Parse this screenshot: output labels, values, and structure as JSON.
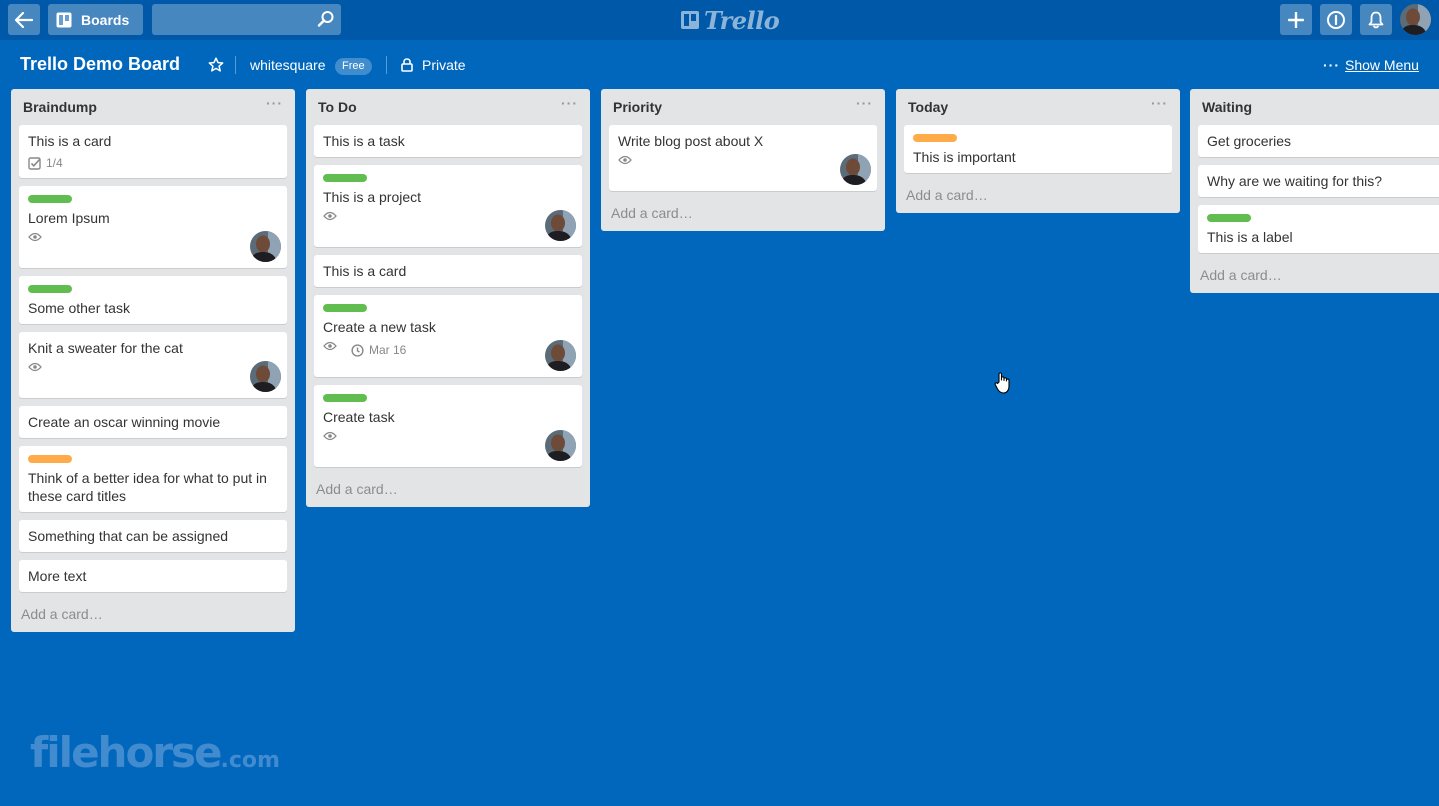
{
  "header": {
    "boards_label": "Boards",
    "search_value": "",
    "logo_text": "Trello",
    "icons": [
      "back-arrow-icon",
      "boards-icon",
      "search-icon",
      "trello-logo-icon",
      "plus-icon",
      "info-icon",
      "bell-icon",
      "user-avatar"
    ]
  },
  "board": {
    "title": "Trello Demo Board",
    "team": "whitesquare",
    "plan_badge": "Free",
    "privacy": "Private",
    "show_menu": "Show Menu",
    "menu_dots": "···"
  },
  "colors": {
    "board_bg": "#0067bd",
    "header_bg": "#0059a8",
    "list_bg": "#e2e4e6",
    "label_green": "#61bd4f",
    "label_orange": "#ffab4a"
  },
  "lists": [
    {
      "title": "Braindump",
      "menu": "···",
      "add_card": "Add a card…",
      "cards": [
        {
          "title": "This is a card",
          "checklist": "1/4"
        },
        {
          "label": "green",
          "title": "Lorem Ipsum"
        },
        {
          "label": "green",
          "title": "Some other task"
        },
        {
          "title": "Knit a sweater for the cat"
        },
        {
          "title": "Create an oscar winning movie"
        },
        {
          "label": "orange",
          "title": "Think of a better idea for what to put in these card titles"
        },
        {
          "title": "Something that can be assigned"
        },
        {
          "title": "More text"
        }
      ]
    },
    {
      "title": "To Do",
      "menu": "···",
      "add_card": "Add a card…",
      "cards": [
        {
          "title": "This is a task"
        },
        {
          "label": "green",
          "title": "This is a project"
        },
        {
          "title": "This is a card"
        },
        {
          "label": "green",
          "title": "Create a new task",
          "due": "Mar 16"
        },
        {
          "label": "green",
          "title": "Create task"
        }
      ]
    },
    {
      "title": "Priority",
      "menu": "···",
      "add_card": "Add a card…",
      "cards": [
        {
          "title": "Write blog post about X"
        }
      ]
    },
    {
      "title": "Today",
      "menu": "···",
      "add_card": "Add a card…",
      "cards": [
        {
          "label": "orange",
          "title": "This is important"
        }
      ]
    },
    {
      "title": "Waiting",
      "menu": "···",
      "add_card": "Add a card…",
      "cards": [
        {
          "title": "Get groceries"
        },
        {
          "title": "Why are we waiting for this?"
        },
        {
          "label": "green",
          "title": "This is a label"
        }
      ]
    }
  ],
  "watermark": {
    "main": "filehorse",
    "suffix": ".com"
  }
}
